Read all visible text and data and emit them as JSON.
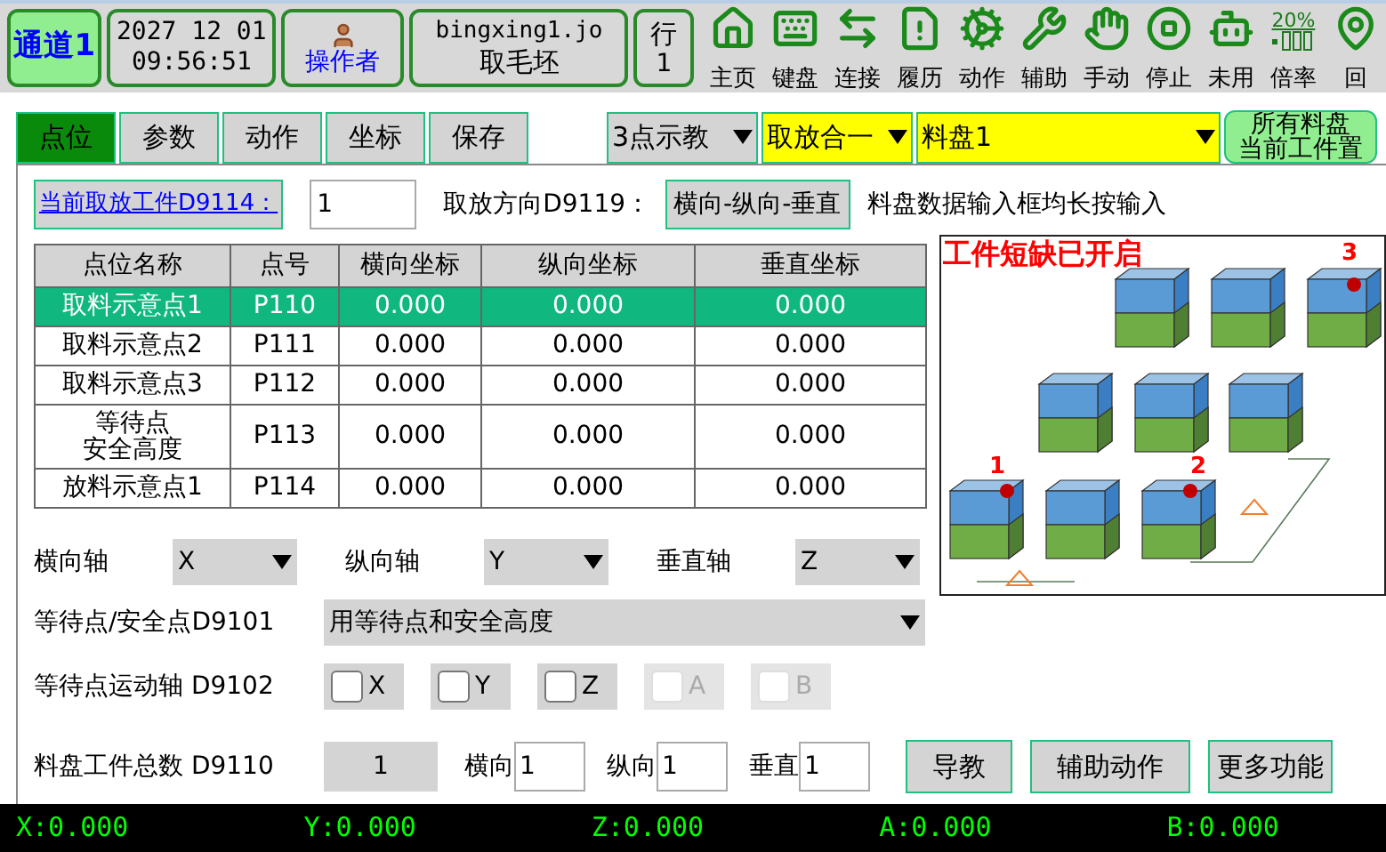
{
  "header": {
    "channel": {
      "label": "通道1",
      "selected": true
    },
    "datetime": [
      "2027 12 01",
      "09:56:51"
    ],
    "operator": "操作者",
    "program": {
      "file": "bingxing1.jo",
      "name": "取毛坯"
    },
    "row": {
      "label": "行",
      "value": "1"
    }
  },
  "toolbar": [
    {
      "kind": "home",
      "label": "主页"
    },
    {
      "kind": "keyboard",
      "label": "键盘"
    },
    {
      "kind": "link",
      "label": "连接"
    },
    {
      "kind": "history",
      "label": "履历"
    },
    {
      "kind": "action",
      "label": "动作"
    },
    {
      "kind": "assist",
      "label": "辅助"
    },
    {
      "kind": "manual",
      "label": "手动"
    },
    {
      "kind": "stop",
      "label": "停止"
    },
    {
      "kind": "unused",
      "label": "未用"
    },
    {
      "kind": "rate",
      "label": "倍率",
      "value": "20%"
    },
    {
      "kind": "origin",
      "label": "回"
    }
  ],
  "tabs": [
    {
      "label": "点位",
      "selected": true
    },
    {
      "label": "参数",
      "selected": false
    },
    {
      "label": "动作",
      "selected": false
    },
    {
      "label": "坐标",
      "selected": false
    },
    {
      "label": "保存",
      "selected": false
    }
  ],
  "selects": [
    {
      "value": "3点示教",
      "highlighted": false
    },
    {
      "value": "取放合一",
      "highlighted": true
    },
    {
      "value": "料盘1",
      "highlighted": true
    }
  ],
  "tray_button": [
    "所有料盘",
    "当前工件置"
  ],
  "current": {
    "button": "当前取放工件D9114：",
    "value": "1",
    "direction_label": "取放方向D9119：",
    "direction_button": "横向-纵向-垂直",
    "note": "料盘数据输入框均长按输入"
  },
  "table": {
    "columns": [
      "点位名称",
      "点号",
      "横向坐标",
      "纵向坐标",
      "垂直坐标"
    ],
    "rows": [
      {
        "cells": [
          "取料示意点1",
          "P110",
          "0.000",
          "0.000",
          "0.000"
        ],
        "selected": true
      },
      {
        "cells": [
          "取料示意点2",
          "P111",
          "0.000",
          "0.000",
          "0.000"
        ],
        "selected": false
      },
      {
        "cells": [
          "取料示意点3",
          "P112",
          "0.000",
          "0.000",
          "0.000"
        ],
        "selected": false
      },
      {
        "cells": [
          [
            "等待点",
            "安全高度"
          ],
          "P113",
          "0.000",
          "0.000",
          "0.000"
        ],
        "selected": false
      },
      {
        "cells": [
          "放料示意点1",
          "P114",
          "0.000",
          "0.000",
          "0.000"
        ],
        "selected": false
      }
    ]
  },
  "diagram": {
    "warning": "工件短缺已开启",
    "markers": [
      "1",
      "2",
      "3"
    ]
  },
  "axes": [
    {
      "label": "横向轴",
      "value": "X"
    },
    {
      "label": "纵向轴",
      "value": "Y"
    },
    {
      "label": "垂直轴",
      "value": "Z"
    }
  ],
  "wait_point": {
    "label": "等待点/安全点D9101",
    "value": "用等待点和安全高度"
  },
  "wait_axes": {
    "label": "等待点运动轴 D9102",
    "items": [
      {
        "label": "X",
        "checked": false,
        "disabled": false
      },
      {
        "label": "Y",
        "checked": false,
        "disabled": false
      },
      {
        "label": "Z",
        "checked": false,
        "disabled": false
      },
      {
        "label": "A",
        "checked": false,
        "disabled": true
      },
      {
        "label": "B",
        "checked": false,
        "disabled": true
      }
    ]
  },
  "totals": {
    "label": "料盘工件总数 D9110",
    "value": "1",
    "fields": [
      {
        "label": "横向",
        "value": "1"
      },
      {
        "label": "纵向",
        "value": "1"
      },
      {
        "label": "垂直",
        "value": "1"
      }
    ]
  },
  "buttons": [
    "导教",
    "辅助动作",
    "更多功能"
  ],
  "status_bar": [
    "X:0.000",
    "Y:0.000",
    "Z:0.000",
    "A:0.000",
    "B:0.000"
  ]
}
